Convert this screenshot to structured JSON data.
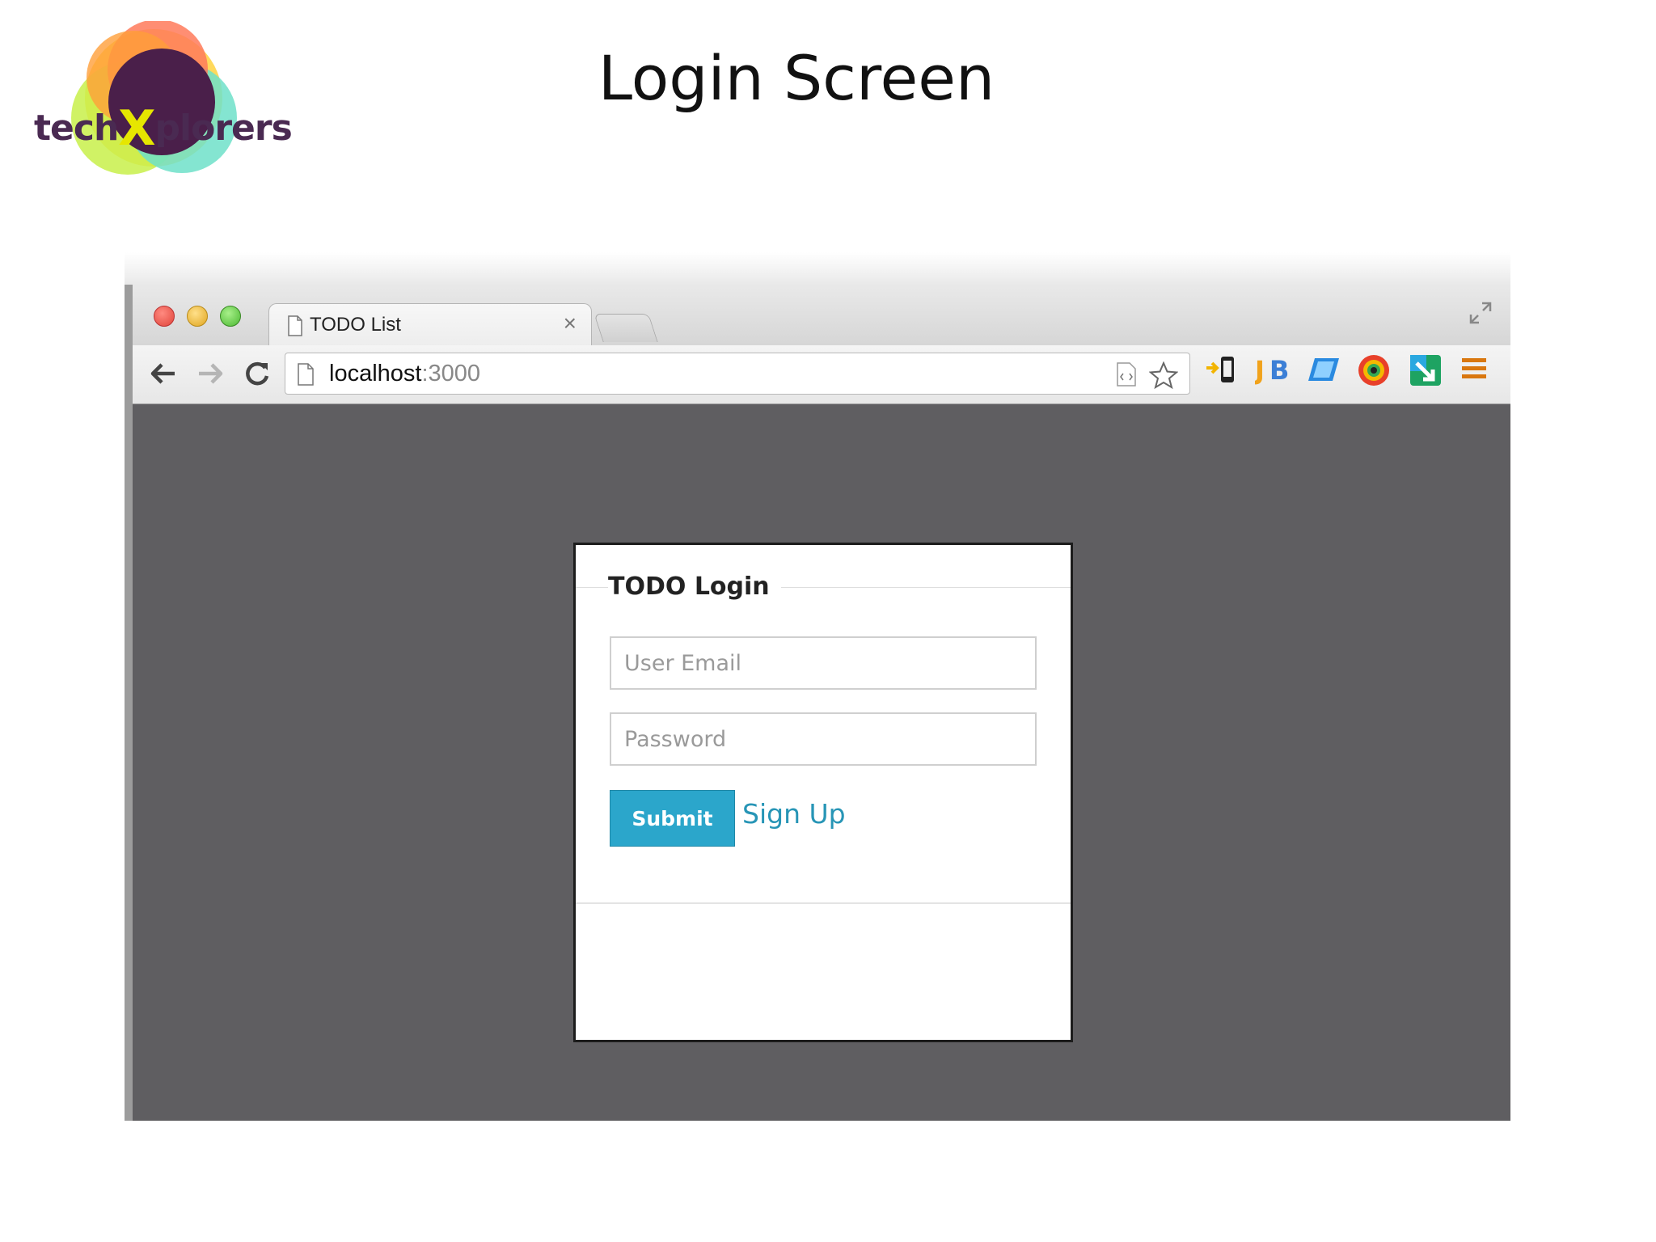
{
  "slide": {
    "title": "Login Screen",
    "logo": {
      "text_before": "tech",
      "text_x": "X",
      "text_after": "plorers"
    }
  },
  "browser": {
    "tab": {
      "title": "TODO List",
      "close": "×"
    },
    "address": {
      "host": "localhost",
      "port": ":3000"
    },
    "icons": [
      "back-icon",
      "forward-icon",
      "reload-icon",
      "page-icon",
      "bookmark-star-icon",
      "chrome-menu-icon"
    ]
  },
  "login": {
    "title": "TODO Login",
    "email_placeholder": "User Email",
    "password_placeholder": "Password",
    "submit_label": "Submit",
    "signup_label": "Sign Up"
  },
  "colors": {
    "page_background": "#5f5e61",
    "submit_button": "#2ba6cb",
    "link": "#2795b6",
    "logo_text": "#4a2a52"
  }
}
